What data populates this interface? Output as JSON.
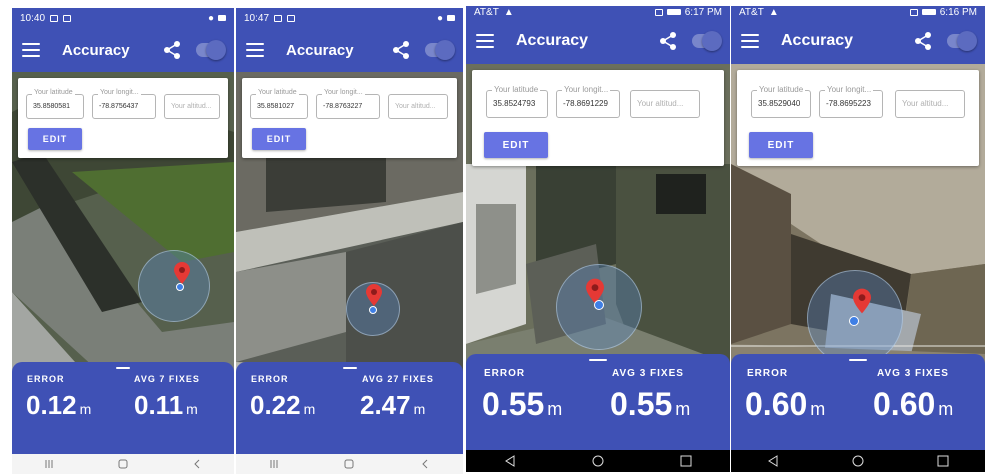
{
  "phones": [
    {
      "status_time": "10:40",
      "status_right": "",
      "app_title": "Accuracy",
      "latitude_label": "Your latitude",
      "latitude_value": "35.8580581",
      "longitude_label": "Your longit...",
      "longitude_value": "-78.8756437",
      "altitude_placeholder": "Your altitud...",
      "edit_label": "EDIT",
      "error_label": "ERROR",
      "error_value": "0.12",
      "error_unit": "m",
      "avg_label": "AVG 7 FIXES",
      "avg_value": "0.11",
      "avg_unit": "m",
      "nav_style": "light",
      "nav_icons": [
        "recents-icon",
        "home-icon",
        "back-icon"
      ]
    },
    {
      "status_time": "10:47",
      "status_right": "",
      "app_title": "Accuracy",
      "latitude_label": "Your latitude",
      "latitude_value": "35.8581027",
      "longitude_label": "Your longit...",
      "longitude_value": "-78.8763227",
      "altitude_placeholder": "Your altitud...",
      "edit_label": "EDIT",
      "error_label": "ERROR",
      "error_value": "0.22",
      "error_unit": "m",
      "avg_label": "AVG 27 FIXES",
      "avg_value": "2.47",
      "avg_unit": "m",
      "nav_style": "light",
      "nav_icons": [
        "recents-icon",
        "home-icon",
        "back-icon"
      ]
    },
    {
      "status_time": "AT&T",
      "status_right": "6:17 PM",
      "app_title": "Accuracy",
      "latitude_label": "Your latitude",
      "latitude_value": "35.8524793",
      "longitude_label": "Your longit...",
      "longitude_value": "-78.8691229",
      "altitude_placeholder": "Your altitud...",
      "edit_label": "EDIT",
      "error_label": "ERROR",
      "error_value": "0.55",
      "error_unit": "m",
      "avg_label": "AVG 3 FIXES",
      "avg_value": "0.55",
      "avg_unit": "m",
      "nav_style": "dark",
      "nav_icons": [
        "back-icon",
        "home-icon",
        "recents-icon"
      ]
    },
    {
      "status_time": "AT&T",
      "status_right": "6:16 PM",
      "app_title": "Accuracy",
      "latitude_label": "Your latitude",
      "latitude_value": "35.8529040",
      "longitude_label": "Your longit...",
      "longitude_value": "-78.8695223",
      "altitude_placeholder": "Your altitud...",
      "edit_label": "EDIT",
      "error_label": "ERROR",
      "error_value": "0.60",
      "error_unit": "m",
      "avg_label": "AVG 3 FIXES",
      "avg_value": "0.60",
      "avg_unit": "m",
      "nav_style": "dark",
      "nav_icons": [
        "back-icon",
        "home-icon",
        "recents-icon"
      ]
    }
  ],
  "colors": {
    "app_bar": "#3f51b5",
    "edit_button": "#6773e3",
    "pin": "#e53935",
    "location_dot": "#3f7fe5"
  }
}
